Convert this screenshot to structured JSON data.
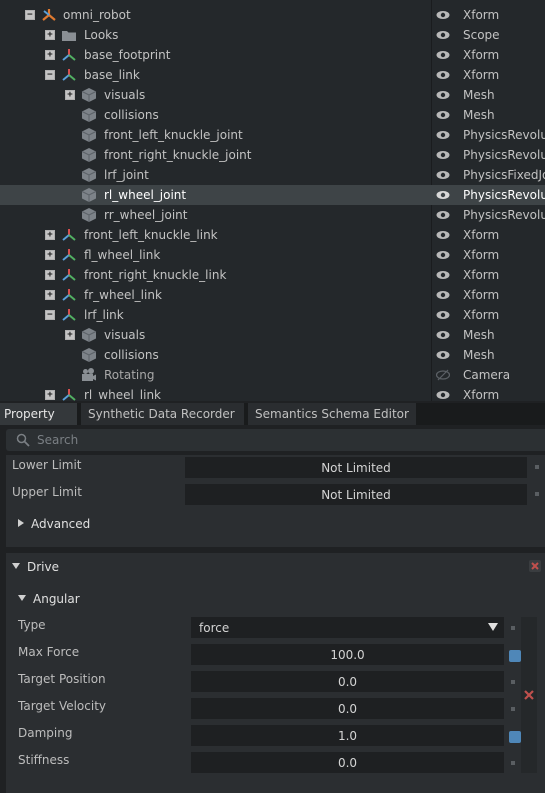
{
  "stage": {
    "rows": [
      {
        "name": "omni_robot",
        "type": "Xform",
        "icon": "xform-icon",
        "toggle": "−"
      },
      {
        "name": "Looks",
        "type": "Scope",
        "icon": "folder-icon",
        "toggle": "+"
      },
      {
        "name": "base_footprint",
        "type": "Xform",
        "icon": "xform-icon",
        "toggle": "+"
      },
      {
        "name": "base_link",
        "type": "Xform",
        "icon": "xform-icon",
        "toggle": "−"
      },
      {
        "name": "visuals",
        "type": "Mesh",
        "icon": "mesh-icon",
        "toggle": "+"
      },
      {
        "name": "collisions",
        "type": "Mesh",
        "icon": "mesh-icon",
        "toggle": ""
      },
      {
        "name": "front_left_knuckle_joint",
        "type": "PhysicsRevolut",
        "icon": "mesh-icon",
        "toggle": ""
      },
      {
        "name": "front_right_knuckle_joint",
        "type": "PhysicsRevolut",
        "icon": "mesh-icon",
        "toggle": ""
      },
      {
        "name": "lrf_joint",
        "type": "PhysicsFixedJo",
        "icon": "mesh-icon",
        "toggle": ""
      },
      {
        "name": "rl_wheel_joint",
        "type": "PhysicsRevolut",
        "icon": "mesh-icon",
        "toggle": ""
      },
      {
        "name": "rr_wheel_joint",
        "type": "PhysicsRevolut",
        "icon": "mesh-icon",
        "toggle": ""
      },
      {
        "name": "front_left_knuckle_link",
        "type": "Xform",
        "icon": "xform-icon",
        "toggle": "+"
      },
      {
        "name": "fl_wheel_link",
        "type": "Xform",
        "icon": "xform-icon",
        "toggle": "+"
      },
      {
        "name": "front_right_knuckle_link",
        "type": "Xform",
        "icon": "xform-icon",
        "toggle": "+"
      },
      {
        "name": "fr_wheel_link",
        "type": "Xform",
        "icon": "xform-icon",
        "toggle": "+"
      },
      {
        "name": "lrf_link",
        "type": "Xform",
        "icon": "xform-icon",
        "toggle": "−"
      },
      {
        "name": "visuals",
        "type": "Mesh",
        "icon": "mesh-icon",
        "toggle": "+"
      },
      {
        "name": "collisions",
        "type": "Mesh",
        "icon": "mesh-icon",
        "toggle": ""
      },
      {
        "name": "Rotating",
        "type": "Camera",
        "icon": "camera-icon",
        "toggle": ""
      },
      {
        "name": "rl_wheel_link",
        "type": "Xform",
        "icon": "xform-icon",
        "toggle": "+"
      }
    ],
    "selected_row": "rl_wheel_joint"
  },
  "tabs": [
    "Property",
    "Synthetic Data Recorder",
    "Semantics Schema Editor"
  ],
  "search": {
    "placeholder": "Search"
  },
  "limits": {
    "lower_label": "Lower Limit",
    "lower_value": "Not Limited",
    "upper_label": "Upper Limit",
    "upper_value": "Not Limited",
    "advanced_label": "Advanced"
  },
  "drive": {
    "title": "Drive",
    "angular_title": "Angular",
    "type_label": "Type",
    "type_value": "force",
    "max_force_label": "Max Force",
    "max_force_value": "100.0",
    "target_position_label": "Target Position",
    "target_position_value": "0.0",
    "target_velocity_label": "Target Velocity",
    "target_velocity_value": "0.0",
    "damping_label": "Damping",
    "damping_value": "1.0",
    "stiffness_label": "Stiffness",
    "stiffness_value": "0.0"
  },
  "colors": {
    "accent_blue": "#4f87b8",
    "close_red": "#c0504d",
    "selection": "#3e4447"
  }
}
